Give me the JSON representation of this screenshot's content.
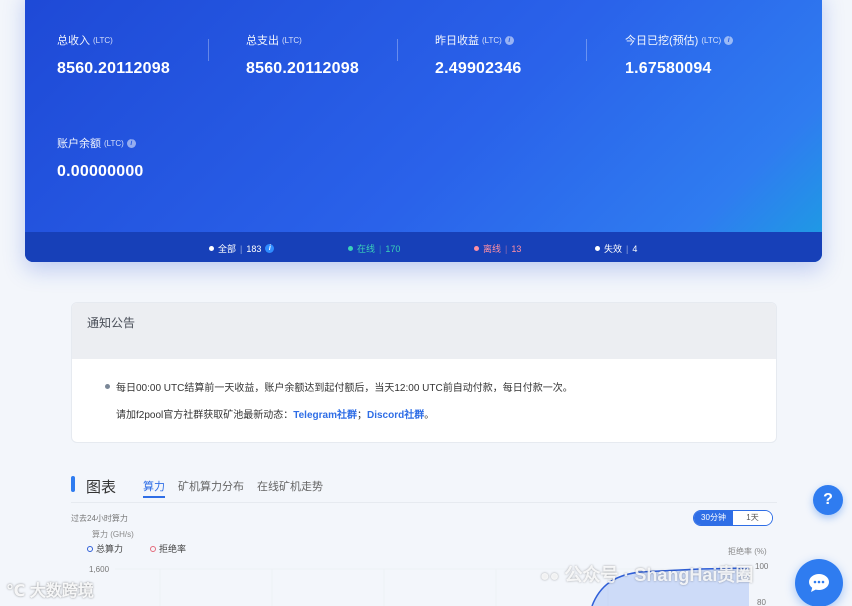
{
  "stats": [
    {
      "label": "总收入",
      "unit": "(LTC)",
      "value": "8560.20112098",
      "info": false
    },
    {
      "label": "总支出",
      "unit": "(LTC)",
      "value": "8560.20112098",
      "info": false
    },
    {
      "label": "昨日收益",
      "unit": "(LTC)",
      "value": "2.49902346",
      "info": true
    },
    {
      "label": "今日已挖(预估)",
      "unit": "(LTC)",
      "value": "1.67580094",
      "info": true
    },
    {
      "label": "账户余额",
      "unit": "(LTC)",
      "value": "0.00000000",
      "info": true
    }
  ],
  "status": {
    "all": {
      "label": "全部",
      "count": "183",
      "color": "#ffffff"
    },
    "online": {
      "label": "在线",
      "count": "170",
      "color": "#3ad1b8"
    },
    "offline": {
      "label": "离线",
      "count": "13",
      "color": "#ff8fa3"
    },
    "invalid": {
      "label": "失效",
      "count": "4",
      "color": "#ffffff"
    }
  },
  "notice": {
    "title": "通知公告",
    "line1": "每日00:00 UTC结算前一天收益，账户余额达到起付额后，当天12:00 UTC前自动付款，每日付款一次。",
    "line2_prefix": "请加f2pool官方社群获取矿池最新动态：",
    "telegram_link": "Telegram社群",
    "sep": "；",
    "discord_link": "Discord社群",
    "end": "。"
  },
  "chart_section": {
    "title": "图表",
    "tabs": [
      "算力",
      "矿机算力分布",
      "在线矿机走势"
    ],
    "active_tab": 0,
    "subtitle": "过去24小时算力",
    "left_unit": "算力 (GH/s)",
    "right_unit": "拒绝率 (%)",
    "legend": [
      "总算力",
      "拒绝率"
    ],
    "ranges": [
      "30分钟",
      "1天"
    ],
    "active_range": 0
  },
  "chart_data": {
    "type": "area",
    "series": [
      {
        "name": "总算力"
      },
      {
        "name": "拒绝率"
      }
    ],
    "y_tick_labels": [
      "1,600"
    ],
    "y2_tick_labels": [
      "100",
      "80"
    ],
    "grid": true
  },
  "floating": {
    "help": "?",
    "watermark_right": "公众号 · ShangHai贵圈",
    "watermark_left": "大数跨境"
  },
  "colors": {
    "accent": "#2f6ee6",
    "hero_start": "#1e49d6",
    "hero_end": "#1c9fe2"
  }
}
